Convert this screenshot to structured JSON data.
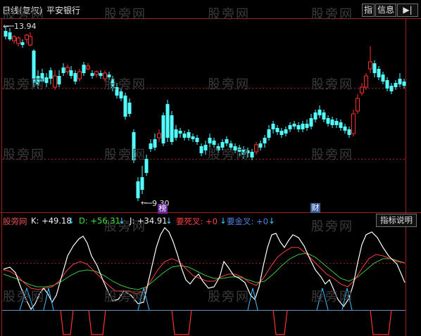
{
  "header": {
    "period_label": "日线(复权)",
    "stock_name": "平安银行",
    "btn_index": "指",
    "btn_info": "信息",
    "btn_arrow": "▶|"
  },
  "watermark": "股旁网",
  "price_panel": {
    "high_label": "13.94",
    "low_label": "9.30",
    "tag_list": "榜",
    "tag_finance": "财"
  },
  "indicator": {
    "name": "股旁网",
    "k_label": "K: +49.18",
    "d_label": "D: +56.31",
    "j_label": "J: +34.91",
    "dead_cross_label": "要死叉: +0",
    "golden_cross_label": "要金叉: +0",
    "arrow": "↓",
    "help_button": "指标说明"
  },
  "colors": {
    "up": "#ff3030",
    "down": "#54ffff",
    "k": "#ffffff",
    "d": "#ffff00",
    "j": "#ff00ff",
    "red_line": "#ff4040",
    "green_line": "#40c040",
    "dead": "#ff3030",
    "golden": "#40c0ff"
  }
}
